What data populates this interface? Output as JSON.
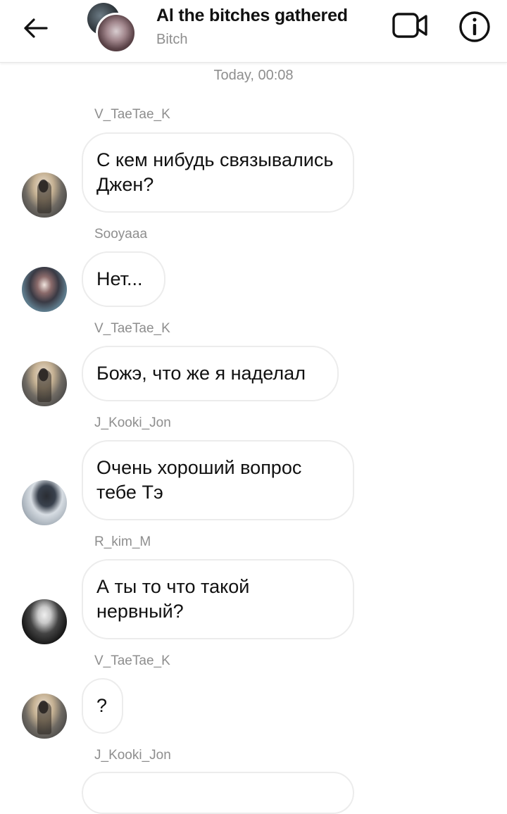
{
  "header": {
    "title": "Al the bitches gathered",
    "subtitle": "Bitch",
    "back_icon": "arrow-left-icon",
    "video_icon": "video-camera-icon",
    "info_icon": "info-circle-icon"
  },
  "chat": {
    "timestamp": "Today, 00:08",
    "messages": [
      {
        "sender": "V_TaeTae_K",
        "text": "С кем нибудь связывались Джен?"
      },
      {
        "sender": "Sooyaaa",
        "text": "Нет..."
      },
      {
        "sender": "V_TaeTae_K",
        "text": "Божэ, что же я наделал"
      },
      {
        "sender": "J_Kooki_Jon",
        "text": "Очень хороший вопрос тебе Тэ"
      },
      {
        "sender": "R_kim_M",
        "text": "А ты то что такой нервный?"
      },
      {
        "sender": "V_TaeTae_K",
        "text": "?"
      },
      {
        "sender": "J_Kooki_Jon",
        "text": ""
      }
    ]
  },
  "colors": {
    "bubble_border": "#ececec",
    "meta_text": "#8e8e8e",
    "text": "#111111"
  }
}
